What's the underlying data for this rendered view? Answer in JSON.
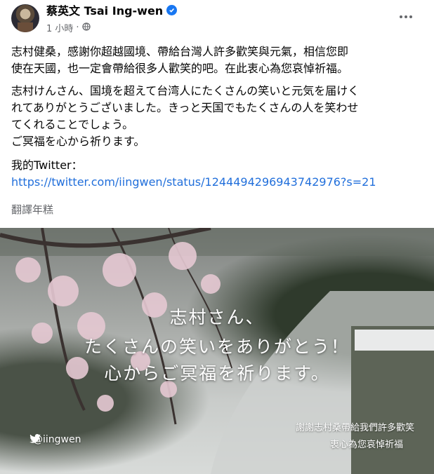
{
  "post": {
    "author": "蔡英文 Tsai Ing-wen",
    "time": "1 小時",
    "separator": "·",
    "paragraph1": [
      "志村健桑，感謝你超越國境、帶給台灣人許多歡笑與元氣，相信您即",
      "使在天國，也一定會帶給很多人歡笑的吧。在此衷心為您哀悼祈福。"
    ],
    "paragraph2": [
      "志村けんさん、国境を超えて台湾人にたくさんの笑いと元気を届けく",
      "れてありがとうございました。きっと天国でもたくさんの人を笑わせ",
      "てくれることでしょう。",
      "ご冥福を心から祈ります。"
    ],
    "twitter_label": "我的Twitter：",
    "twitter_link": "https://twitter.com/iingwen/status/1244494296943742976?s=21",
    "translate": "翻譯年糕"
  },
  "photo": {
    "line1": "志村さん、",
    "line2": "たくさんの笑いをありがとう！",
    "line3": "心からご冥福を祈ります。",
    "caption1": "謝謝志村桑帶給我們許多歡笑",
    "caption2": "衷心為您哀悼祈福",
    "handle": "@iingwen"
  },
  "icons": {
    "verified": "verified-badge-icon",
    "audience": "globe-icon",
    "more": "more-options-icon",
    "twitter": "twitter-bird-icon"
  },
  "colors": {
    "link": "#216fdb",
    "verified": "#1877f2",
    "secondary_text": "#65676b"
  }
}
